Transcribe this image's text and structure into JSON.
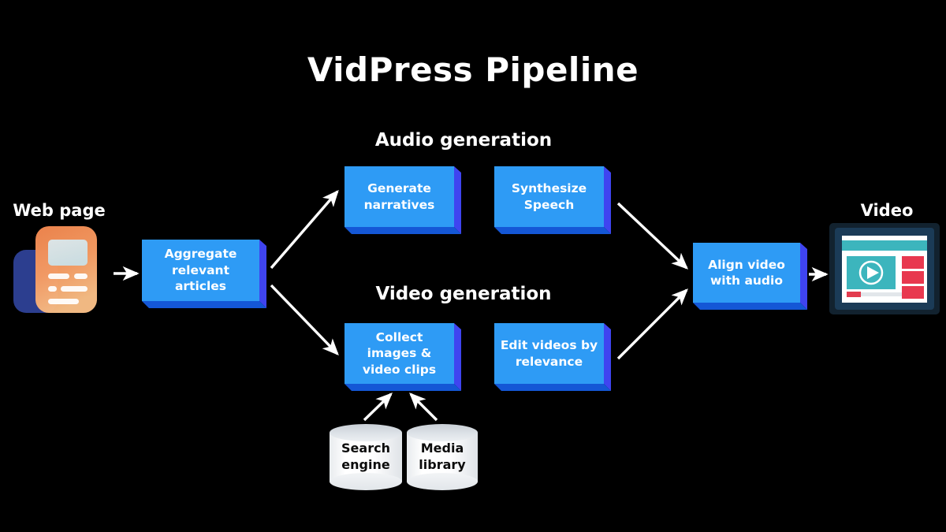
{
  "diagram": {
    "title": "VidPress Pipeline",
    "background_color": "#000000",
    "box_face_color": "#2E9BF5",
    "box_shadow_color": "#1457D6",
    "text_color": "#FFFFFF",
    "sections": [
      {
        "id": "audio",
        "label": "Audio generation"
      },
      {
        "id": "video",
        "label": "Video generation"
      }
    ],
    "endpoints": [
      {
        "id": "webpage",
        "label": "Web page",
        "icon": "webpage-document-icon"
      },
      {
        "id": "video-out",
        "label": "Video",
        "icon": "video-player-screen-icon"
      }
    ],
    "process_boxes": [
      {
        "id": "aggregate",
        "line1": "Aggregate",
        "line2": "relevant articles"
      },
      {
        "id": "generate-narratives",
        "line1": "Generate",
        "line2": "narratives"
      },
      {
        "id": "synthesize-speech",
        "line1": "Synthesize",
        "line2": "Speech"
      },
      {
        "id": "collect-images",
        "line1": "Collect images &",
        "line2": "video clips"
      },
      {
        "id": "edit-videos",
        "line1": "Edit videos by",
        "line2": "relevance"
      },
      {
        "id": "align-video",
        "line1": "Align video",
        "line2": "with audio"
      }
    ],
    "data_stores": [
      {
        "id": "search-engine",
        "line1": "Search",
        "line2": "engine"
      },
      {
        "id": "media-library",
        "line1": "Media",
        "line2": "library"
      }
    ],
    "connectors": [
      {
        "from": "webpage",
        "to": "aggregate",
        "style": "straight-right"
      },
      {
        "from": "aggregate",
        "to": "generate-narratives",
        "style": "diagonal-up-right"
      },
      {
        "from": "aggregate",
        "to": "collect-images",
        "style": "diagonal-down-right"
      },
      {
        "from": "synthesize-speech",
        "to": "align-video",
        "style": "diagonal-down-right"
      },
      {
        "from": "edit-videos",
        "to": "align-video",
        "style": "diagonal-up-right"
      },
      {
        "from": "search-engine",
        "to": "collect-images",
        "style": "diagonal-up-right"
      },
      {
        "from": "media-library",
        "to": "collect-images",
        "style": "diagonal-up-left"
      },
      {
        "from": "align-video",
        "to": "video-out",
        "style": "straight-right"
      }
    ]
  }
}
